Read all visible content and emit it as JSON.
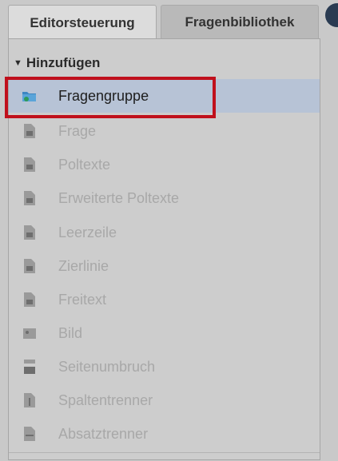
{
  "tabs": [
    {
      "label": "Editorsteuerung",
      "active": true
    },
    {
      "label": "Fragenbibliothek",
      "active": false
    }
  ],
  "section": {
    "label": "Hinzufügen",
    "expanded": true
  },
  "items": [
    {
      "label": "Fragengruppe",
      "icon": "folder-icon",
      "enabled": true
    },
    {
      "label": "Frage",
      "icon": "document-icon",
      "enabled": false
    },
    {
      "label": "Poltexte",
      "icon": "document-icon",
      "enabled": false
    },
    {
      "label": "Erweiterte Poltexte",
      "icon": "document-icon",
      "enabled": false
    },
    {
      "label": "Leerzeile",
      "icon": "document-icon",
      "enabled": false
    },
    {
      "label": "Zierlinie",
      "icon": "document-icon",
      "enabled": false
    },
    {
      "label": "Freitext",
      "icon": "document-icon",
      "enabled": false
    },
    {
      "label": "Bild",
      "icon": "image-icon",
      "enabled": false
    },
    {
      "label": "Seitenumbruch",
      "icon": "page-break-icon",
      "enabled": false
    },
    {
      "label": "Spaltentrenner",
      "icon": "column-separator-icon",
      "enabled": false
    },
    {
      "label": "Absatztrenner",
      "icon": "paragraph-separator-icon",
      "enabled": false
    }
  ],
  "colors": {
    "highlight": "#c0101c",
    "selected_row": "#b7c3d6",
    "disabled_text": "#a8a8a8"
  }
}
